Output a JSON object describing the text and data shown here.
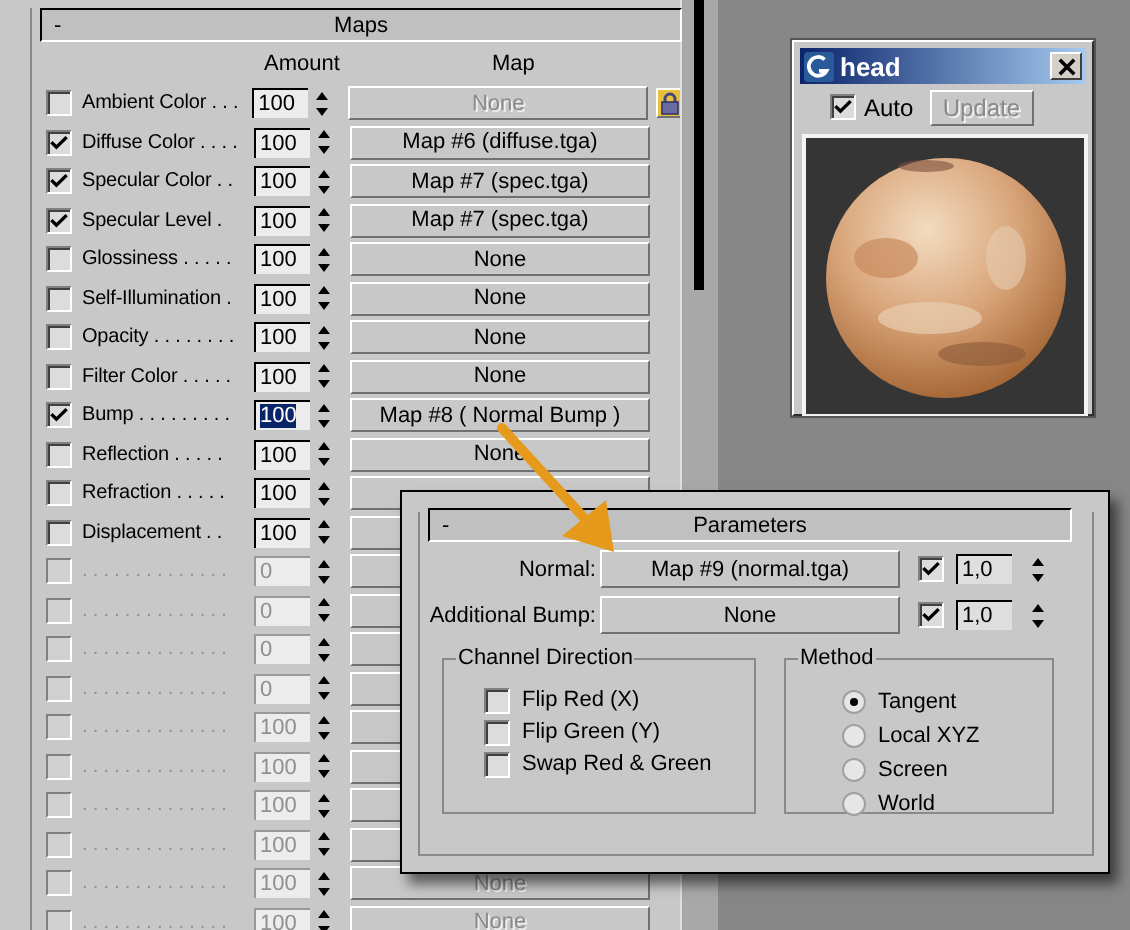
{
  "maps_rollout": {
    "collapse": "-",
    "title": "Maps",
    "columns": [
      "Amount",
      "Map"
    ],
    "rows": [
      {
        "enabled": true,
        "checked": false,
        "label": "Ambient Color . . .",
        "amount": "100",
        "amount_selected": false,
        "map": "None",
        "map_disabled": true
      },
      {
        "enabled": true,
        "checked": true,
        "label": "Diffuse Color . . . .",
        "amount": "100",
        "amount_selected": false,
        "map": "Map #6 (diffuse.tga)",
        "map_disabled": false
      },
      {
        "enabled": true,
        "checked": true,
        "label": "Specular Color  . .",
        "amount": "100",
        "amount_selected": false,
        "map": "Map #7 (spec.tga)",
        "map_disabled": false
      },
      {
        "enabled": true,
        "checked": true,
        "label": "Specular Level  .",
        "amount": "100",
        "amount_selected": false,
        "map": "Map #7 (spec.tga)",
        "map_disabled": false
      },
      {
        "enabled": true,
        "checked": false,
        "label": "Glossiness  . . . . .",
        "amount": "100",
        "amount_selected": false,
        "map": "None",
        "map_disabled": false
      },
      {
        "enabled": true,
        "checked": false,
        "label": "Self-Illumination .",
        "amount": "100",
        "amount_selected": false,
        "map": "None",
        "map_disabled": false
      },
      {
        "enabled": true,
        "checked": false,
        "label": "Opacity . . . . . . . .",
        "amount": "100",
        "amount_selected": false,
        "map": "None",
        "map_disabled": false
      },
      {
        "enabled": true,
        "checked": false,
        "label": "Filter Color  . . . . .",
        "amount": "100",
        "amount_selected": false,
        "map": "None",
        "map_disabled": false
      },
      {
        "enabled": true,
        "checked": true,
        "label": "Bump  . . . . . . . . .",
        "amount": "100",
        "amount_selected": true,
        "map": "Map #8  ( Normal Bump )",
        "map_disabled": false
      },
      {
        "enabled": true,
        "checked": false,
        "label": "Reflection  . . . . .",
        "amount": "100",
        "amount_selected": false,
        "map": "None",
        "map_disabled": false
      },
      {
        "enabled": true,
        "checked": false,
        "label": "Refraction  . . . . .",
        "amount": "100",
        "amount_selected": false
      },
      {
        "enabled": true,
        "checked": false,
        "label": "Displacement  . .",
        "amount": "100",
        "amount_selected": false
      },
      {
        "enabled": false,
        "checked": false,
        "label": ". . . . . . . . . . . . . .",
        "amount": "0",
        "amount_selected": false
      },
      {
        "enabled": false,
        "checked": false,
        "label": ". . . . . . . . . . . . . .",
        "amount": "0",
        "amount_selected": false
      },
      {
        "enabled": false,
        "checked": false,
        "label": ". . . . . . . . . . . . . .",
        "amount": "0",
        "amount_selected": false
      },
      {
        "enabled": false,
        "checked": false,
        "label": ". . . . . . . . . . . . . .",
        "amount": "0",
        "amount_selected": false
      },
      {
        "enabled": false,
        "checked": false,
        "label": ". . . . . . . . . . . . . .",
        "amount": "100",
        "amount_selected": false
      },
      {
        "enabled": false,
        "checked": false,
        "label": ". . . . . . . . . . . . . .",
        "amount": "100",
        "amount_selected": false
      },
      {
        "enabled": false,
        "checked": false,
        "label": ". . . . . . . . . . . . . .",
        "amount": "100",
        "amount_selected": false
      },
      {
        "enabled": false,
        "checked": false,
        "label": ". . . . . . . . . . . . . .",
        "amount": "100",
        "amount_selected": false
      },
      {
        "enabled": false,
        "checked": false,
        "label": ". . . . . . . . . . . . . .",
        "amount": "100",
        "amount_selected": false,
        "map": "None",
        "map_disabled": true
      },
      {
        "enabled": false,
        "checked": false,
        "label": ". . . . . . . . . . . . . .",
        "amount": "100",
        "amount_selected": false,
        "map": "None",
        "map_disabled": true
      }
    ]
  },
  "preview_window": {
    "title": "head",
    "auto": {
      "label": "Auto",
      "checked": true
    },
    "update": {
      "label": "Update",
      "disabled": true
    }
  },
  "parameters_window": {
    "collapse": "-",
    "title": "Parameters",
    "maps": [
      {
        "label": "Normal:",
        "map": "Map #9 (normal.tga)",
        "checked": true,
        "amount": "1,0"
      },
      {
        "label": "Additional Bump:",
        "map": "None",
        "checked": true,
        "amount": "1,0"
      }
    ],
    "channel_direction": {
      "title": "Channel Direction",
      "options": [
        {
          "label": "Flip Red (X)",
          "checked": false
        },
        {
          "label": "Flip Green (Y)",
          "checked": false
        },
        {
          "label": "Swap Red & Green",
          "checked": false
        }
      ]
    },
    "method": {
      "title": "Method",
      "options": [
        {
          "label": "Tangent",
          "selected": true
        },
        {
          "label": "Local XYZ",
          "selected": false
        },
        {
          "label": "Screen",
          "selected": false
        },
        {
          "label": "World",
          "selected": false
        }
      ]
    }
  }
}
